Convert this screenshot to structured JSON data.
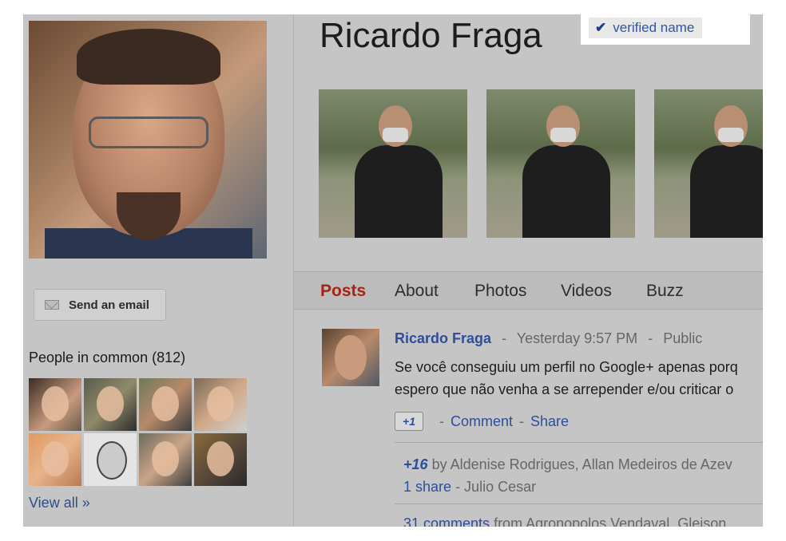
{
  "profile": {
    "name": "Ricardo Fraga",
    "verified_label": "verified name"
  },
  "sidebar": {
    "send_email_label": "Send an email",
    "people_in_common_label": "People in common (812)",
    "view_all_label": "View all »"
  },
  "tabs": [
    {
      "label": "Posts",
      "active": true
    },
    {
      "label": "About",
      "active": false
    },
    {
      "label": "Photos",
      "active": false
    },
    {
      "label": "Videos",
      "active": false
    },
    {
      "label": "Buzz",
      "active": false
    }
  ],
  "post": {
    "author": "Ricardo Fraga",
    "time": "Yesterday 9:57 PM",
    "visibility": "Public",
    "text_line1": "Se você conseguiu um perfil no Google+ apenas porq",
    "text_line2": "espero que não venha a se arrepender e/ou criticar o",
    "plusone_label": "+1",
    "comment_label": "Comment",
    "share_label": "Share",
    "plus_count": "+16",
    "plus_by": "by Aldenise Rodrigues, Allan Medeiros de Azev",
    "shares_link": "1 share",
    "shares_by": "- Julio Cesar",
    "comments_link": "31 comments",
    "comments_from": "from Agronopolos Vendaval, Gleison"
  },
  "colors": {
    "active_tab": "#a82312",
    "link": "#2e4d9a",
    "background": "#c5c5c5"
  }
}
